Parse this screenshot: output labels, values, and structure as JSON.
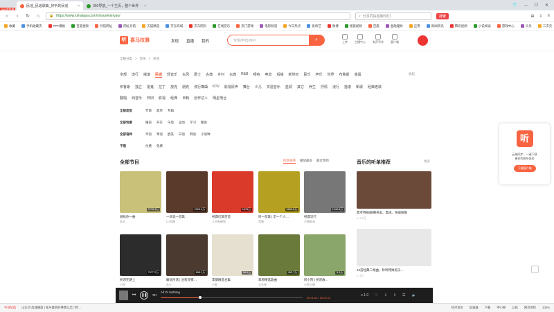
{
  "browser": {
    "tabs": [
      {
        "label": "民谣_民谣歌曲_好听的民谣",
        "color": "#f86442",
        "active": true
      },
      {
        "label": "360导航_一个主页，整个世界",
        "color": "#2a9a2a",
        "active": false
      }
    ],
    "badge": "360浏览器",
    "url": "https://www.ximalaya.com/yinyue/minyao/",
    "search_placeholder": "分享同好腔聊你们",
    "search_button": "搜索",
    "bookmarks": [
      "收藏",
      "手机收藏夹",
      "PPT模板",
      "百度搜索",
      "导航网址",
      "网址导航",
      "天猫精选",
      "京东商城",
      "京东网页",
      "在线音乐",
      "热门游戏",
      "电影频道",
      "今日热点",
      "爱奇艺",
      "微博",
      "搜狐视频",
      "百度",
      "金融理财",
      "应用",
      "新闻资讯",
      "腾讯视频",
      "小说阅读",
      "游戏中心",
      "头条",
      "二次元",
      "民谣_民谣"
    ]
  },
  "site": {
    "logo_text": "喜马拉雅",
    "nav": [
      "发现",
      "直播",
      "我的"
    ],
    "search_placeholder": "专辑/声音/用户",
    "tools": [
      "上传",
      "主播中心",
      "有声写作",
      "客户端"
    ]
  },
  "breadcrumb": [
    "全部分类",
    ">",
    "音乐",
    ">",
    "民谣"
  ],
  "categories_row1": [
    "全部",
    "流行",
    "摇滚",
    "民谣",
    "轻音乐",
    "古风",
    "爵士",
    "古典",
    "乡村",
    "古典",
    "R&B",
    "嘻哈",
    "电音",
    "后摇",
    "新世纪",
    "民乐",
    "声乐",
    "世界",
    "布鲁斯",
    "金属"
  ],
  "categories_row2": [
    "布鲁斯",
    "独立",
    "雷鬼",
    "拉丁",
    "放克",
    "朋克",
    "流行舞曲",
    "KTV",
    "影视原声",
    "舞台",
    "少儿",
    "实验音乐",
    "蓝调",
    "其它",
    "养生",
    "抒情",
    "流行",
    "摇滚",
    "新歌",
    "经典老歌"
  ],
  "categories_row3": [
    "翻唱",
    "纯音乐",
    "怀旧",
    "影视",
    "经典",
    "日韩",
    "创作达人",
    "明星电台"
  ],
  "more_label": "收起",
  "filters": [
    {
      "label": "全部类型",
      "options": [
        "节目",
        "歌单",
        "专辑"
      ]
    },
    {
      "label": "全部场景",
      "options": [
        "睡前",
        "开车",
        "午后",
        "运动",
        "学习",
        "聚会"
      ]
    },
    {
      "label": "全部语种",
      "options": [
        "华语",
        "粤语",
        "欧美",
        "日语",
        "韩语",
        "小语种"
      ]
    },
    {
      "label": "不限",
      "options": [
        "付费",
        "免费"
      ]
    }
  ],
  "section_all": "全部节目",
  "sort_tabs": [
    "综合排序",
    "播放最多",
    "最近更新"
  ],
  "section_rec": "音乐的听单推荐",
  "rec_more": "更多",
  "albums": [
    {
      "title": "她给你一曲",
      "sub": "朱丰",
      "plays": "3778.3万",
      "color": "#c9c07a"
    },
    {
      "title": "一日说一首歌",
      "sub": "DJ阿峰",
      "plays": "2206.4万",
      "color": "#5a3a2a"
    },
    {
      "title": "经典红歌百首",
      "sub": "人间有静阁",
      "plays": "1576万",
      "color": "#d93a2a"
    },
    {
      "title": "听一首歌 | 走一个人…",
      "sub": "黑墨",
      "plays": "6663.6万",
      "color": "#b5a022"
    },
    {
      "title": "经典流行",
      "sub": "主播叔叔",
      "plays": "1046.8万",
      "color": "#777777"
    },
    {
      "title": "民谣在路上",
      "sub": "小鱼",
      "plays": "7677.2万",
      "color": "#2c2c2c"
    },
    {
      "title": "解忧民谣 | 治愈深夜…",
      "sub": "花火",
      "plays": "898.1万",
      "color": "#4a3a30"
    },
    {
      "title": "李健精选合集",
      "sub": "小麦",
      "plays": "98.5万",
      "color": "#e6e0d0"
    },
    {
      "title": "草原精选歌曲",
      "sub": "马头琴",
      "plays": "450.7万",
      "color": "#6a7a3a"
    },
    {
      "title": "听小院 | 民谣故…",
      "sub": "小院主播",
      "plays": "3.3万",
      "color": "#8aa66a"
    }
  ],
  "recs": [
    {
      "title": "典考特质|解嘲英美、集成、快速解脱",
      "sub": "▷ 3.9万",
      "color": "#6b4a3a"
    },
    {
      "title": "10首经典二胡曲，聆听韩殊民乐…",
      "sub": "▷ 1万",
      "color": "#e8e8e8"
    }
  ],
  "promo": {
    "title": "云端同步，一键下载",
    "sub": "更好的收听体验",
    "button": "下载客户端",
    "logo": "听"
  },
  "player": {
    "track": "All Or Nothing",
    "time": "00:01:03 / 00:03:14",
    "progress": 0.28,
    "speed": "x 1.0"
  },
  "statusbar": {
    "left": [
      "今日优选",
      "山东诗 高速播放 | 家乡做到的事情让出门时…"
    ],
    "right": [
      "热点资讯",
      "加速器",
      "下载",
      "中小网",
      "以前",
      "网页体检",
      "100%"
    ]
  }
}
